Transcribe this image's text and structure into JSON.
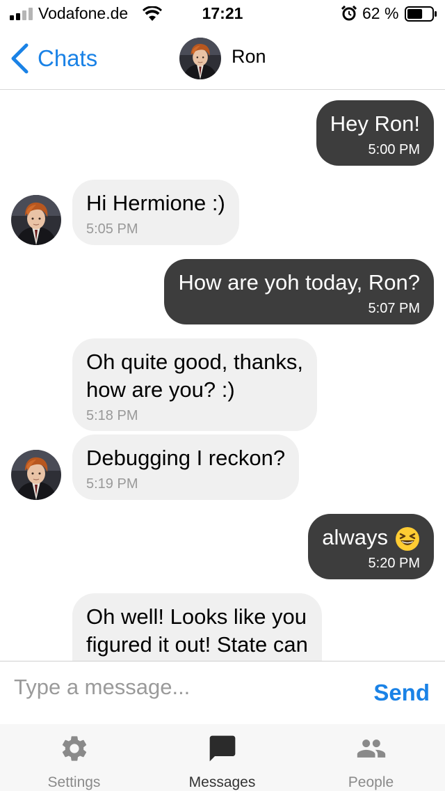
{
  "status_bar": {
    "carrier": "Vodafone.de",
    "time": "17:21",
    "battery_percent": "62 %",
    "battery_level": 0.62,
    "signal_bars_filled": 2
  },
  "header": {
    "back_label": "Chats",
    "contact_name": "Ron"
  },
  "messages": [
    {
      "direction": "sent",
      "text": "Hey Ron!",
      "time": "5:00 PM"
    },
    {
      "direction": "received",
      "text": "Hi Hermione :)",
      "time": "5:05 PM"
    },
    {
      "direction": "sent",
      "text": "How are yoh today, Ron?",
      "time": "5:07 PM"
    },
    {
      "direction": "received",
      "text": "Oh quite good, thanks,\nhow are you? :)",
      "time": "5:18 PM"
    },
    {
      "direction": "received",
      "text": "Debugging I reckon?",
      "time": "5:19 PM"
    },
    {
      "direction": "sent",
      "text": "always",
      "time": "5:20 PM",
      "emoji": "grinning-squinting-face"
    },
    {
      "direction": "received",
      "text": "Oh well! Looks like you\nfigured it out! State can",
      "time": ""
    }
  ],
  "composer": {
    "placeholder": "Type a message...",
    "value": "",
    "send_label": "Send"
  },
  "tabs": [
    {
      "label": "Settings",
      "icon": "gear-icon",
      "active": false
    },
    {
      "label": "Messages",
      "icon": "chat-bubble-icon",
      "active": true
    },
    {
      "label": "People",
      "icon": "people-icon",
      "active": false
    }
  ],
  "colors": {
    "accent": "#1a82e6",
    "sent_bubble": "#3d3d3d",
    "received_bubble": "#f0f0f0"
  }
}
